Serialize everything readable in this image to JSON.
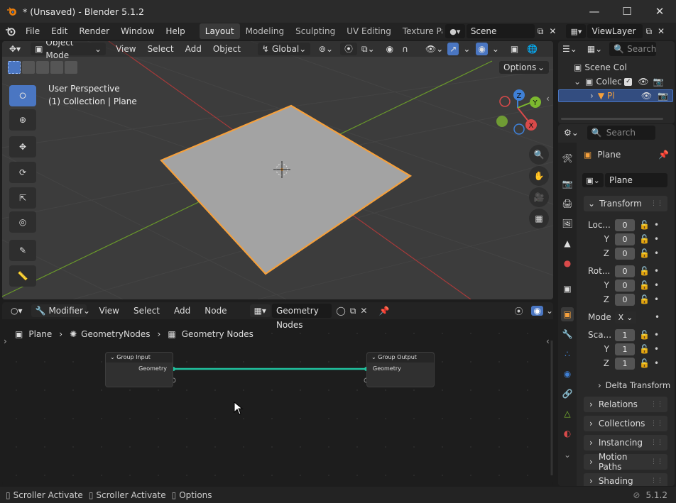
{
  "window": {
    "title": "* (Unsaved) - Blender 5.1.2"
  },
  "menubar": {
    "menus": [
      "File",
      "Edit",
      "Render",
      "Window",
      "Help"
    ],
    "workspaces": [
      "Layout",
      "Modeling",
      "Sculpting",
      "UV Editing",
      "Texture Pai"
    ],
    "scene": "Scene",
    "view_layer": "ViewLayer"
  },
  "viewport": {
    "mode": "Object Mode",
    "menus": [
      "View",
      "Select",
      "Add",
      "Object"
    ],
    "orientation": "Global",
    "options": "Options",
    "info_line1": "User Perspective",
    "info_line2": "(1) Collection | Plane",
    "gizmo": {
      "x": "X",
      "y": "Y",
      "z": "Z"
    }
  },
  "node_editor": {
    "type": "Modifier",
    "menus": [
      "View",
      "Select",
      "Add",
      "Node"
    ],
    "tree_name": "Geometry Nodes",
    "breadcrumb": [
      "Plane",
      "GeometryNodes",
      "Geometry Nodes"
    ],
    "group_input": {
      "title": "Group Input",
      "socket": "Geometry"
    },
    "group_output": {
      "title": "Group Output",
      "socket": "Geometry"
    }
  },
  "outliner": {
    "search_placeholder": "Search",
    "scene_collection": "Scene Col",
    "collection": "Collec",
    "object": "Pl"
  },
  "properties": {
    "search_placeholder": "Search",
    "object_name": "Plane",
    "object_field": "Plane",
    "transform_label": "Transform",
    "location_label": "Loc...",
    "rotation_label": "Rot...",
    "scale_label": "Sca...",
    "mode_label": "Mode",
    "mode_value": "X",
    "axis_y": "Y",
    "axis_z": "Z",
    "location": [
      "0",
      "0",
      "0"
    ],
    "rotation": [
      "0",
      "0",
      "0"
    ],
    "scale": [
      "1",
      "1",
      "1"
    ],
    "delta_transform": "Delta Transform",
    "panels": [
      "Relations",
      "Collections",
      "Instancing",
      "Motion Paths",
      "Shading"
    ]
  },
  "statusbar": {
    "items": [
      "Scroller Activate",
      "Scroller Activate",
      "Options"
    ],
    "version": "5.1.2"
  },
  "colors": {
    "accent": "#4a76c2",
    "selection": "#f5a03c",
    "x_axis": "#d94a4a",
    "y_axis": "#7cb82f",
    "z_axis": "#3f80d6",
    "geometry_link": "#20c4a0"
  }
}
